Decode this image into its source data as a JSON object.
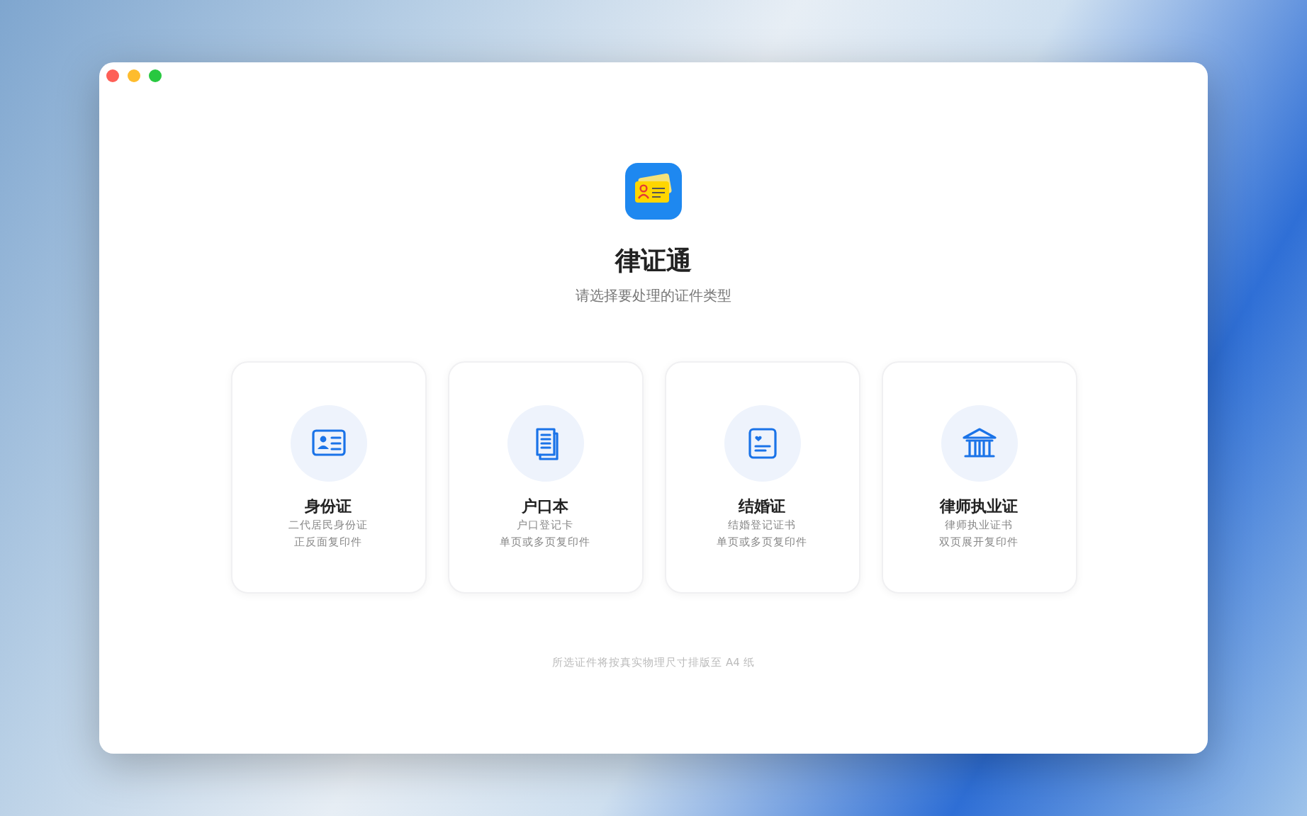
{
  "app": {
    "title": "律证通",
    "subtitle": "请选择要处理的证件类型"
  },
  "cards": [
    {
      "kind": "id-card",
      "title": "身份证",
      "lines": [
        "二代居民身份证",
        "正反面复印件"
      ]
    },
    {
      "kind": "booklet",
      "title": "户口本",
      "lines": [
        "户口登记卡",
        "单页或多页复印件"
      ]
    },
    {
      "kind": "certificate",
      "title": "结婚证",
      "lines": [
        "结婚登记证书",
        "单页或多页复印件"
      ]
    },
    {
      "kind": "building",
      "title": "律师执业证",
      "lines": [
        "律师执业证书",
        "双页展开复印件"
      ]
    }
  ],
  "footer": "所选证件将按真实物理尺寸排版至 A4 纸"
}
